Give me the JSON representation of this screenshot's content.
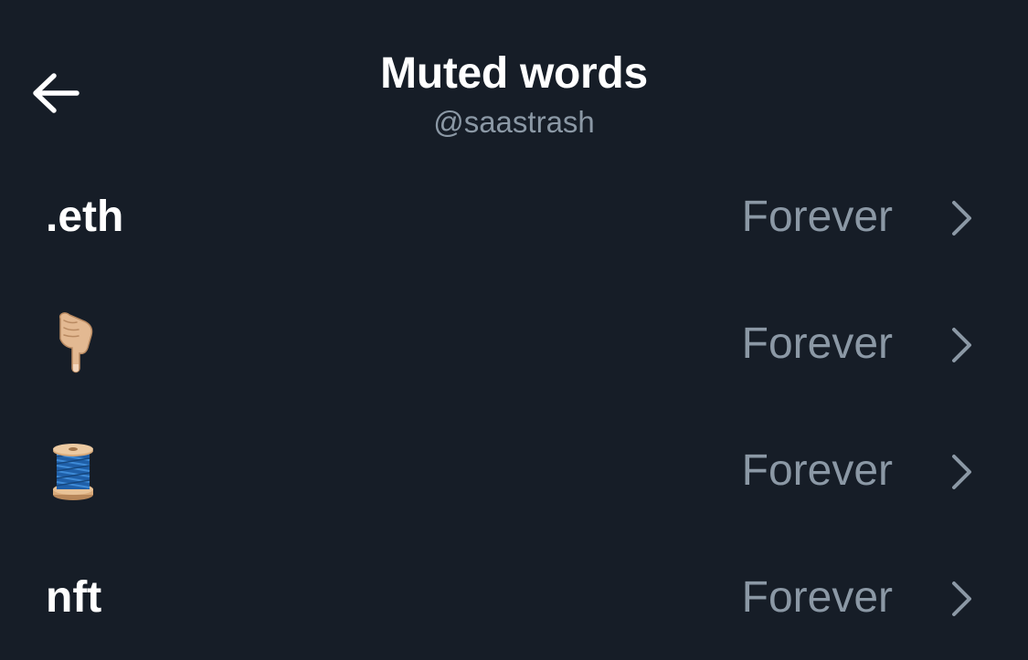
{
  "header": {
    "title": "Muted words",
    "subtitle": "@saastrash",
    "back_icon": "arrow-left-icon"
  },
  "muted_words": [
    {
      "word": ".eth",
      "duration": "Forever",
      "type": "text"
    },
    {
      "word": "👇🏼",
      "duration": "Forever",
      "type": "emoji",
      "icon": "pointing-down-hand-icon"
    },
    {
      "word": "🧵",
      "duration": "Forever",
      "type": "emoji",
      "icon": "thread-spool-icon"
    },
    {
      "word": "nft",
      "duration": "Forever",
      "type": "text"
    }
  ],
  "colors": {
    "background": "#161d27",
    "primary_text": "#ffffff",
    "secondary_text": "#8b98a5"
  }
}
